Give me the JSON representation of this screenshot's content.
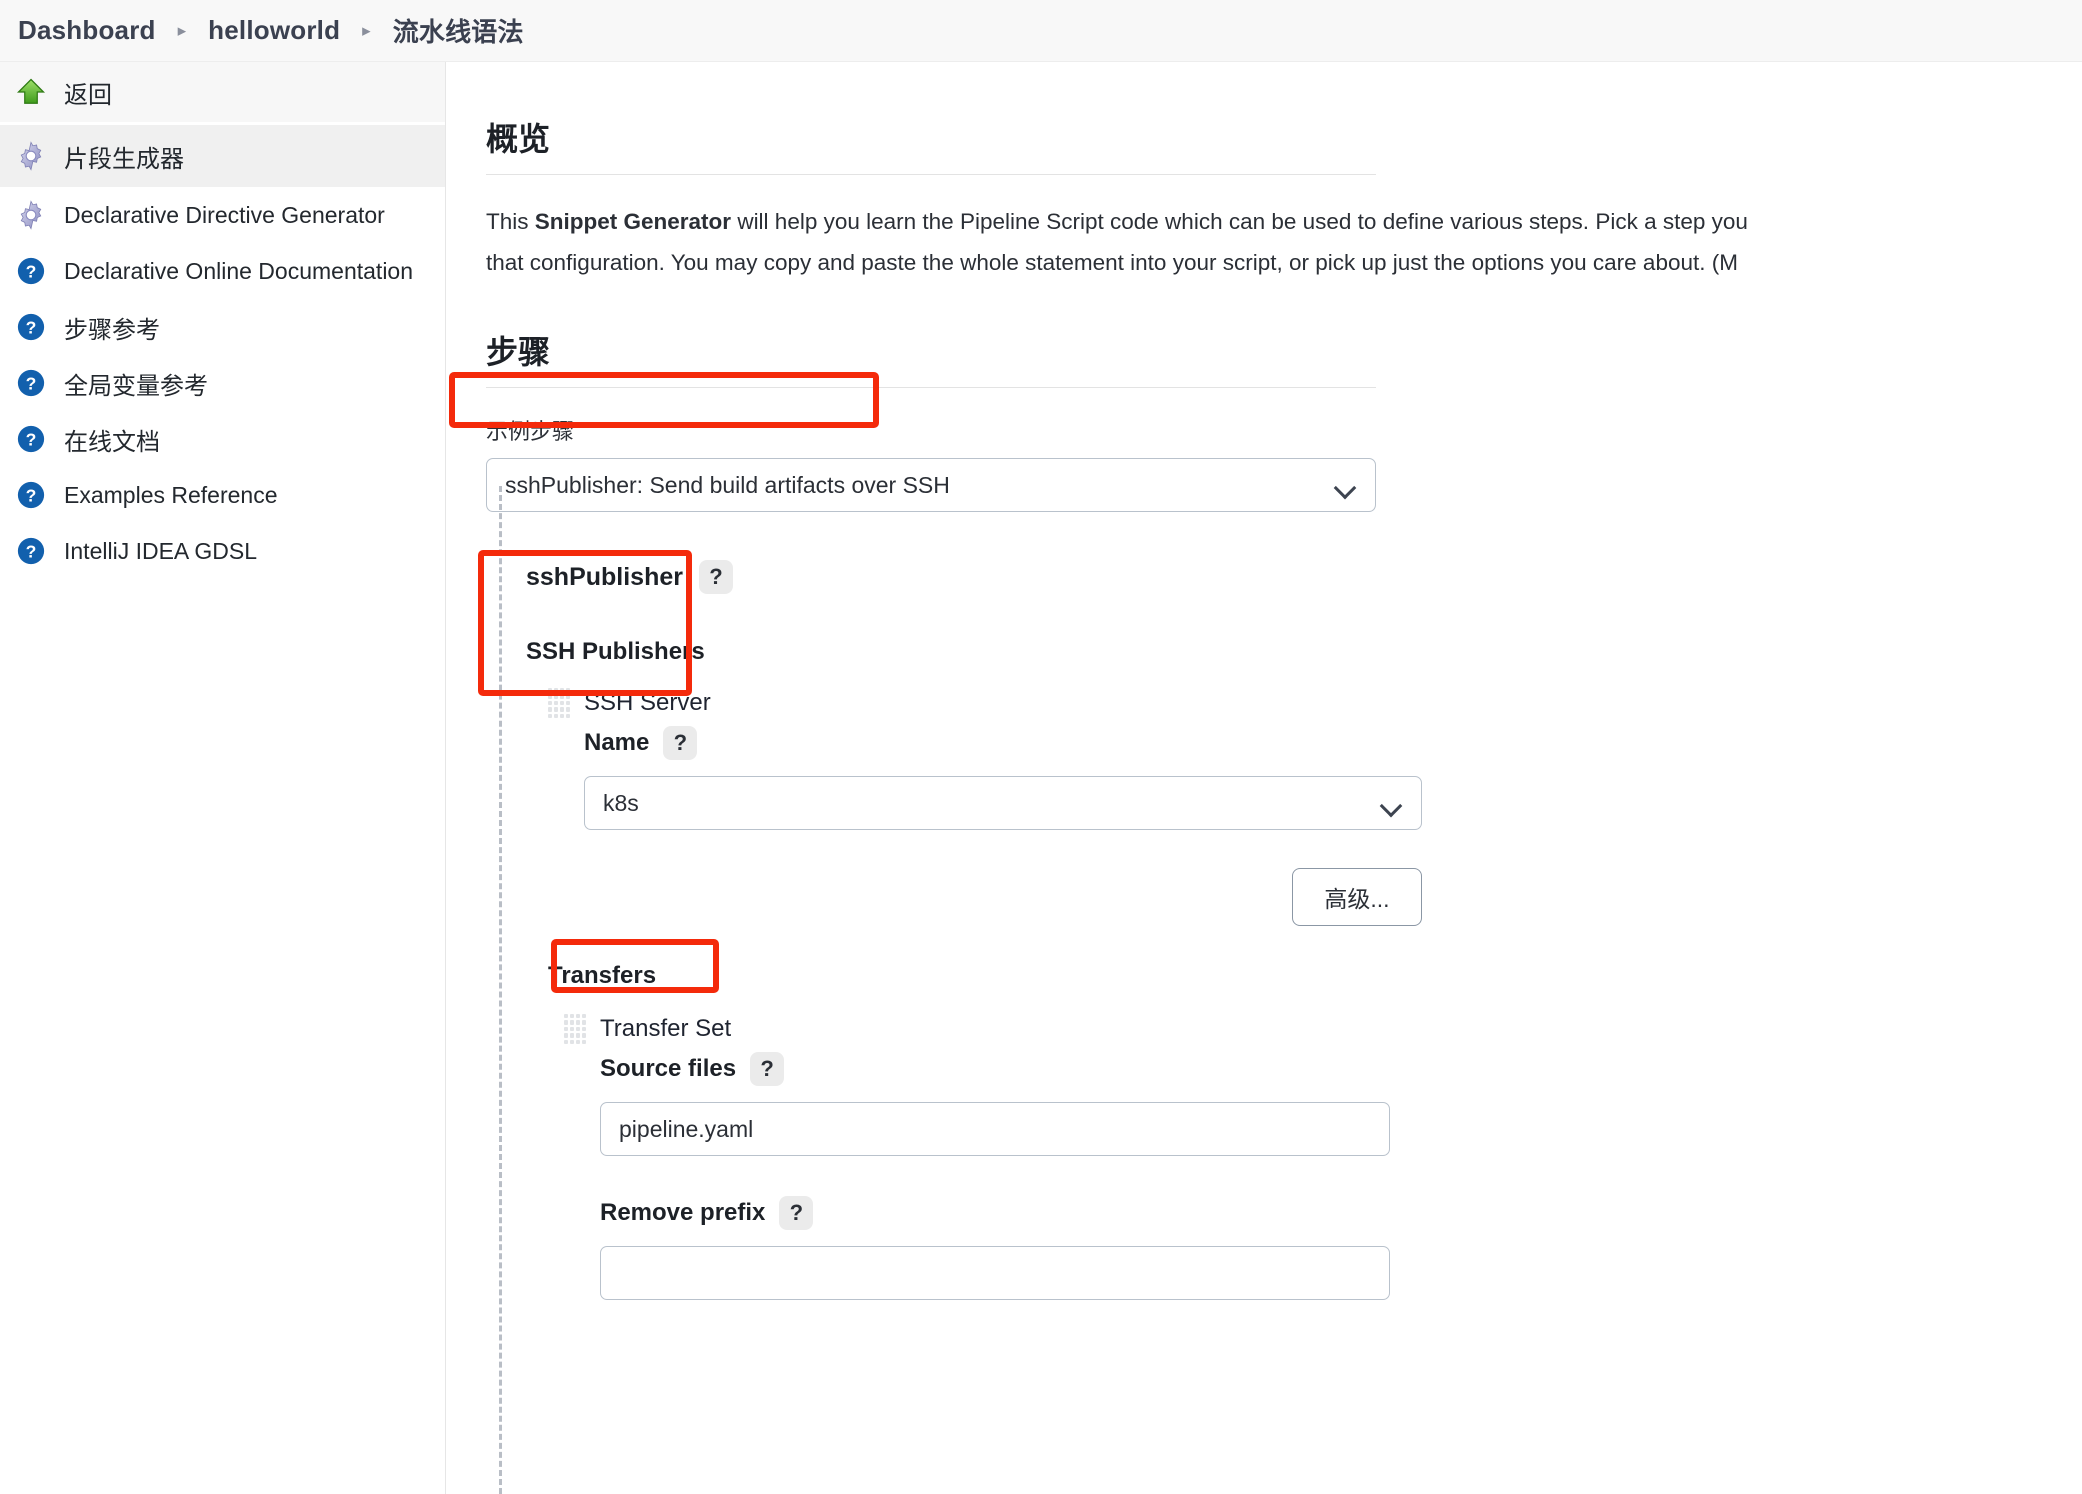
{
  "breadcrumb": {
    "items": [
      "Dashboard",
      "helloworld",
      "流水线语法"
    ],
    "separator": "▸"
  },
  "sidebar": {
    "items": [
      {
        "label": "返回",
        "icon": "up-arrow-icon"
      },
      {
        "label": "片段生成器",
        "icon": "gear-icon"
      },
      {
        "label": "Declarative Directive Generator",
        "icon": "gear-icon"
      },
      {
        "label": "Declarative Online Documentation",
        "icon": "help-circle-icon"
      },
      {
        "label": "步骤参考",
        "icon": "help-circle-icon"
      },
      {
        "label": "全局变量参考",
        "icon": "help-circle-icon"
      },
      {
        "label": "在线文档",
        "icon": "help-circle-icon"
      },
      {
        "label": "Examples Reference",
        "icon": "help-circle-icon"
      },
      {
        "label": "IntelliJ IDEA GDSL",
        "icon": "help-circle-icon"
      }
    ]
  },
  "overview": {
    "title": "概览",
    "line1_pre": "This ",
    "line1_bold": "Snippet Generator",
    "line1_post": " will help you learn the Pipeline Script code which can be used to define various steps. Pick a step you",
    "line2": "that configuration. You may copy and paste the whole statement into your script, or pick up just the options you care about. (M"
  },
  "steps": {
    "title": "步骤",
    "sample_label": "示例步骤",
    "sample_value": "sshPublisher: Send build artifacts over SSH",
    "group_title": "sshPublisher",
    "help_glyph": "?",
    "publishers_title": "SSH Publishers",
    "ssh_server_title": "SSH Server",
    "name_label": "Name",
    "name_value": "k8s",
    "advanced_button": "高级...",
    "transfers_title": "Transfers",
    "transfer_set_title": "Transfer Set",
    "source_files_label": "Source files",
    "source_files_value": "pipeline.yaml",
    "remove_prefix_label": "Remove prefix",
    "remove_prefix_value": ""
  },
  "colors": {
    "annotation": "#f42a0b",
    "sidebar_active": "#f0f0f0",
    "help_badge": "#ebebeb",
    "border": "#b9c2cc"
  }
}
